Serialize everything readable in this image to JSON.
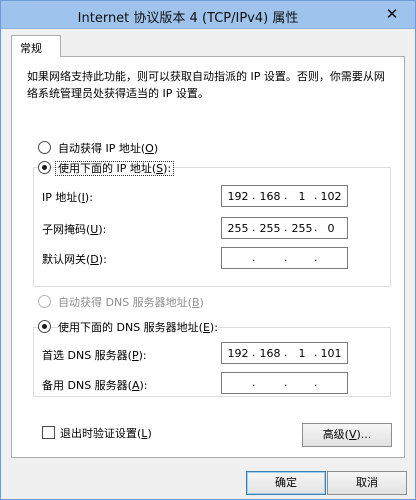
{
  "window": {
    "title": "Internet 协议版本 4 (TCP/IPv4) 属性",
    "close_glyph": "✕"
  },
  "tabs": [
    {
      "label": "常规"
    }
  ],
  "description": "如果网络支持此功能，则可以获取自动指派的 IP 设置。否则，你需要从网络系统管理员处获得适当的 IP 设置。",
  "ip_mode": {
    "auto": {
      "label": "自动获得 IP 地址(",
      "key": "O",
      "suffix": ")"
    },
    "manual": {
      "label": "使用下面的 IP 地址(",
      "key": "S",
      "suffix": "):"
    }
  },
  "ip_fields": [
    {
      "label": "IP 地址(",
      "key": "I",
      "suffix": "):",
      "octets": [
        "192",
        "168",
        "1",
        "102"
      ]
    },
    {
      "label": "子网掩码(",
      "key": "U",
      "suffix": "):",
      "octets": [
        "255",
        "255",
        "255",
        "0"
      ]
    },
    {
      "label": "默认网关(",
      "key": "D",
      "suffix": "):",
      "octets": [
        "",
        "",
        "",
        ""
      ]
    }
  ],
  "dns_mode": {
    "auto": {
      "label": "自动获得 DNS 服务器地址(",
      "key": "B",
      "suffix": ")"
    },
    "manual": {
      "label": "使用下面的 DNS 服务器地址(",
      "key": "E",
      "suffix": "):"
    }
  },
  "dns_fields": [
    {
      "label": "首选 DNS 服务器(",
      "key": "P",
      "suffix": "):",
      "octets": [
        "192",
        "168",
        "1",
        "101"
      ]
    },
    {
      "label": "备用 DNS 服务器(",
      "key": "A",
      "suffix": "):",
      "octets": [
        "",
        "",
        "",
        ""
      ]
    }
  ],
  "validate": {
    "label": "退出时验证设置(",
    "key": "L",
    "suffix": ")"
  },
  "advanced_button": {
    "label": "高级(",
    "key": "V",
    "suffix": ")..."
  },
  "ok_button": "确定",
  "cancel_button": "取消",
  "dot_glyph": "."
}
